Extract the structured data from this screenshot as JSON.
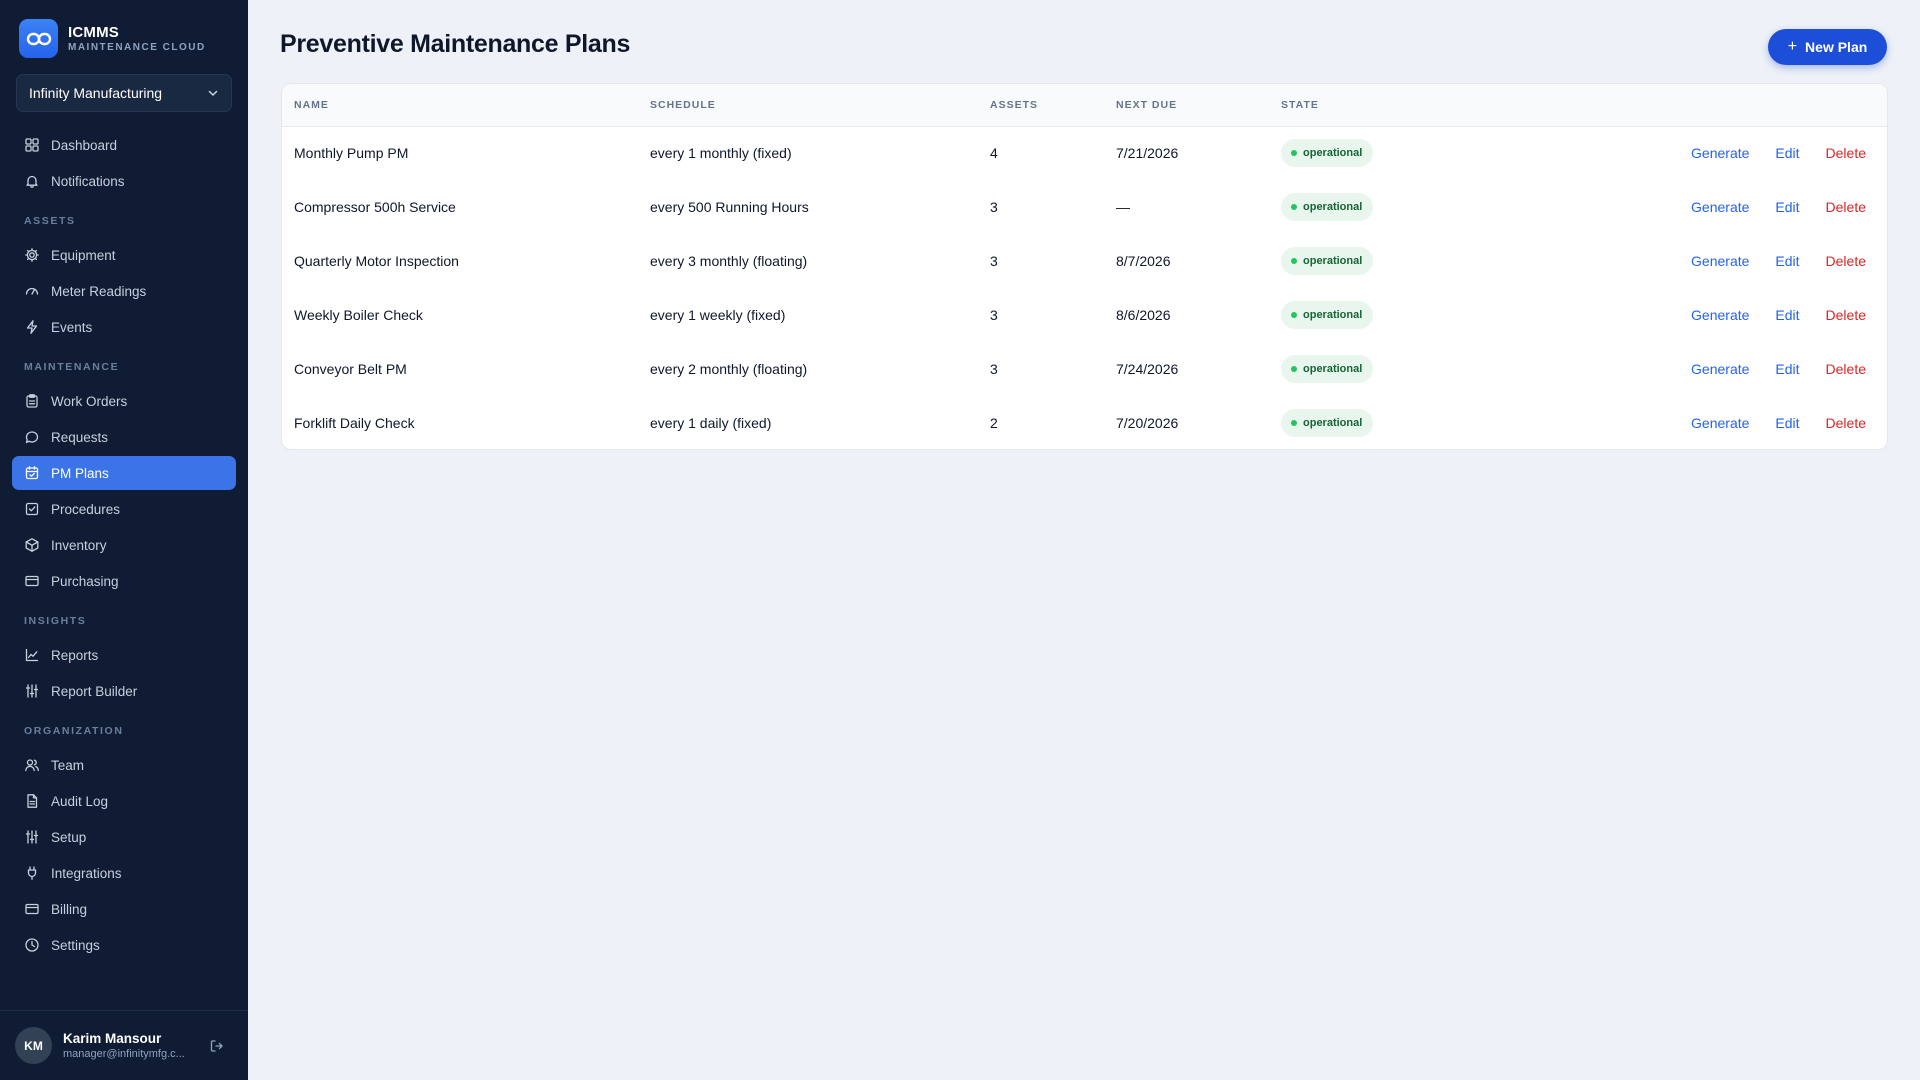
{
  "brand": {
    "name": "ICMMS",
    "subtitle": "MAINTENANCE CLOUD"
  },
  "org_selector": {
    "value": "Infinity Manufacturing"
  },
  "nav": {
    "top": [
      {
        "label": "Dashboard",
        "icon": "dashboard-icon"
      },
      {
        "label": "Notifications",
        "icon": "bell-icon"
      }
    ],
    "sections": [
      {
        "title": "ASSETS",
        "items": [
          {
            "label": "Equipment",
            "icon": "gear-icon"
          },
          {
            "label": "Meter Readings",
            "icon": "gauge-icon"
          },
          {
            "label": "Events",
            "icon": "bolt-icon"
          }
        ]
      },
      {
        "title": "MAINTENANCE",
        "items": [
          {
            "label": "Work Orders",
            "icon": "clipboard-icon"
          },
          {
            "label": "Requests",
            "icon": "chat-icon"
          },
          {
            "label": "PM Plans",
            "icon": "calendar-icon",
            "active": true
          },
          {
            "label": "Procedures",
            "icon": "checkbox-icon"
          },
          {
            "label": "Inventory",
            "icon": "box-icon"
          },
          {
            "label": "Purchasing",
            "icon": "card-icon"
          }
        ]
      },
      {
        "title": "INSIGHTS",
        "items": [
          {
            "label": "Reports",
            "icon": "line-chart-icon"
          },
          {
            "label": "Report Builder",
            "icon": "sliders-icon"
          }
        ]
      },
      {
        "title": "ORGANIZATION",
        "items": [
          {
            "label": "Team",
            "icon": "users-icon"
          },
          {
            "label": "Audit Log",
            "icon": "document-icon"
          },
          {
            "label": "Setup",
            "icon": "sliders-icon"
          },
          {
            "label": "Integrations",
            "icon": "plug-icon"
          },
          {
            "label": "Billing",
            "icon": "card-icon"
          },
          {
            "label": "Settings",
            "icon": "clock-icon"
          }
        ]
      }
    ]
  },
  "user": {
    "initials": "KM",
    "name": "Karim Mansour",
    "email": "manager@infinitymfg.c..."
  },
  "page": {
    "title": "Preventive Maintenance Plans",
    "new_button": "New Plan"
  },
  "table": {
    "columns": [
      "NAME",
      "SCHEDULE",
      "ASSETS",
      "NEXT DUE",
      "STATE"
    ],
    "rows": [
      {
        "name": "Monthly Pump PM",
        "schedule": "every 1 monthly (fixed)",
        "assets": "4",
        "next_due": "7/21/2026",
        "state": "operational"
      },
      {
        "name": "Compressor 500h Service",
        "schedule": "every 500 Running Hours",
        "assets": "3",
        "next_due": "—",
        "state": "operational"
      },
      {
        "name": "Quarterly Motor Inspection",
        "schedule": "every 3 monthly (floating)",
        "assets": "3",
        "next_due": "8/7/2026",
        "state": "operational"
      },
      {
        "name": "Weekly Boiler Check",
        "schedule": "every 1 weekly (fixed)",
        "assets": "3",
        "next_due": "8/6/2026",
        "state": "operational"
      },
      {
        "name": "Conveyor Belt PM",
        "schedule": "every 2 monthly (floating)",
        "assets": "3",
        "next_due": "7/24/2026",
        "state": "operational"
      },
      {
        "name": "Forklift Daily Check",
        "schedule": "every 1 daily (fixed)",
        "assets": "2",
        "next_due": "7/20/2026",
        "state": "operational"
      }
    ],
    "actions": {
      "generate": "Generate",
      "edit": "Edit",
      "delete": "Delete"
    }
  },
  "colors": {
    "sidebar_bg": "#0f1c33",
    "accent": "#3b74e6",
    "primary_button": "#1d4ed8",
    "danger": "#dc2626",
    "success": "#22c55e"
  }
}
